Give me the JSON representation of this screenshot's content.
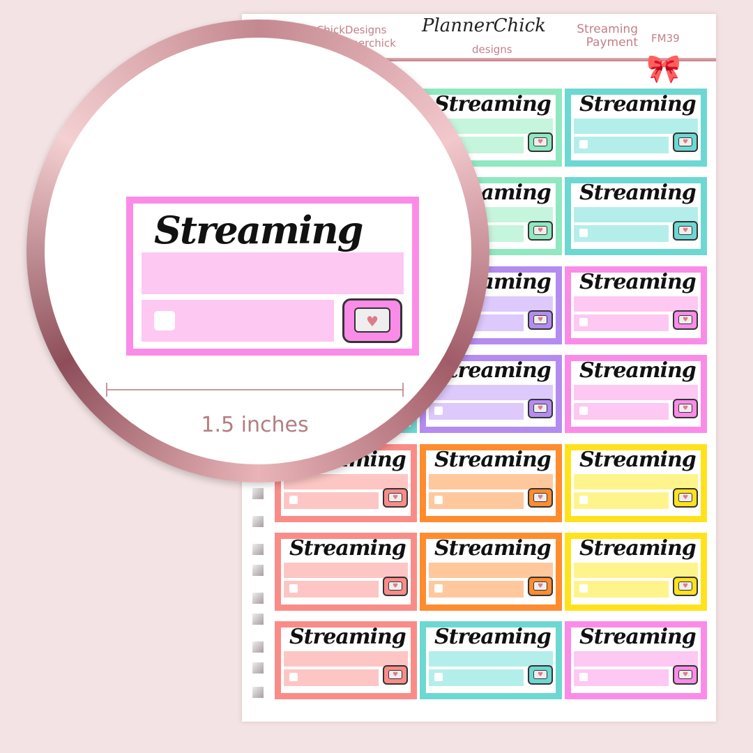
{
  "header": {
    "facebook": "PlannerChickDesigns",
    "instagram": "@plannerchick",
    "logo": "PlannerChick",
    "logo_sub": "designs",
    "title_line1": "Streaming",
    "title_line2": "Payment",
    "code": "FM39"
  },
  "sticker_word": "Streaming",
  "colors": {
    "mint": [
      "#8fe8c0",
      "#c6f5dd"
    ],
    "teal": [
      "#6dd8d2",
      "#b4eeea"
    ],
    "purple": [
      "#b48cf0",
      "#ddc9fb"
    ],
    "pink": [
      "#fa8ce8",
      "#fdc8f2"
    ],
    "salmon": [
      "#fa8c88",
      "#fdc6c4"
    ],
    "orange": [
      "#ff8c2e",
      "#ffc89c"
    ],
    "yellow": [
      "#ffe21e",
      "#fff48c"
    ]
  },
  "grid": [
    [
      "teal",
      "mint",
      "teal"
    ],
    [
      "teal",
      "mint",
      "teal"
    ],
    [
      "purple",
      "purple",
      "pink"
    ],
    [
      "teal",
      "purple",
      "pink"
    ],
    [
      "salmon",
      "orange",
      "yellow"
    ],
    [
      "salmon",
      "orange",
      "yellow"
    ],
    [
      "salmon",
      "teal",
      "pink"
    ]
  ],
  "zoom": {
    "label": "1.5 inches",
    "color": "pink"
  }
}
